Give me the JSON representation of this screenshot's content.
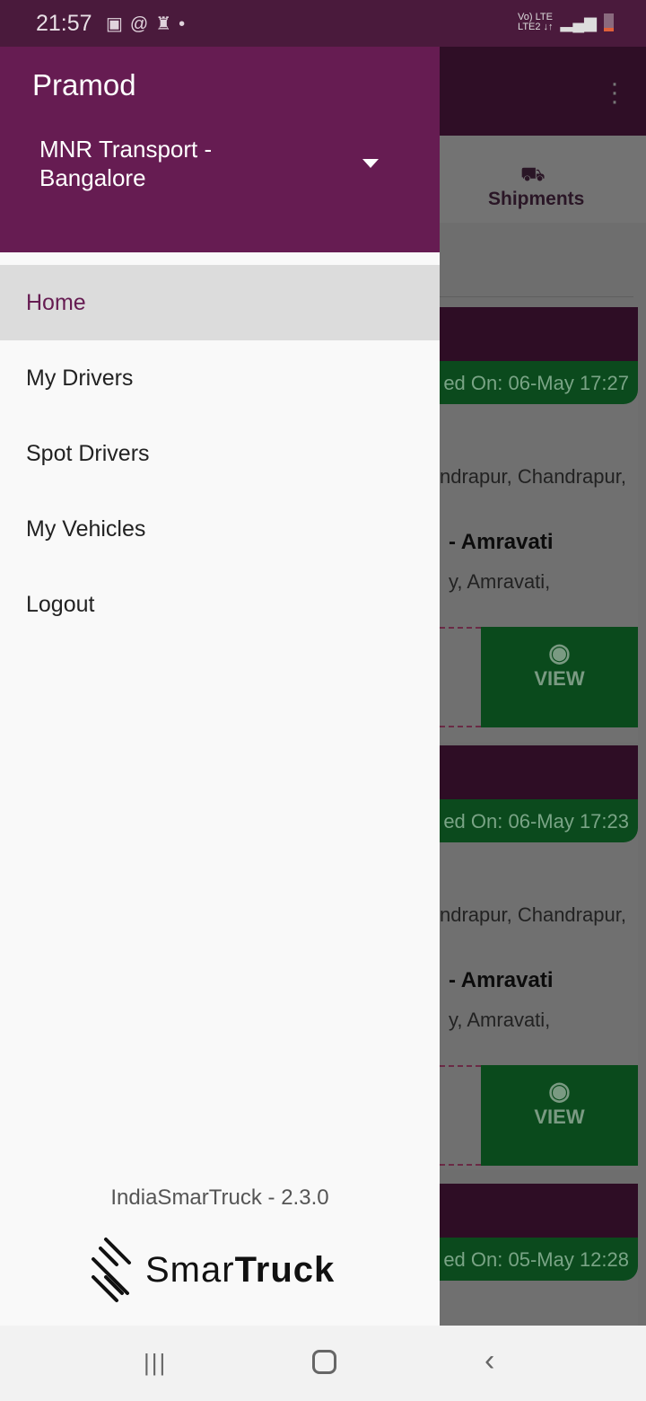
{
  "status_bar": {
    "time": "21:57",
    "left_icons": [
      "gallery-icon",
      "sync-icon",
      "trophy-icon",
      "dot-icon"
    ],
    "network": "VoLTE LTE2",
    "battery": "low"
  },
  "background": {
    "tab": "Shipments",
    "cards": [
      {
        "pill": "ed On: 06-May 17:27",
        "from": "ndrapur, Chandrapur,",
        "to": "- Amravati",
        "to_addr": "y, Amravati,",
        "view": "VIEW"
      },
      {
        "pill": "ed On: 06-May 17:23",
        "from": "ndrapur, Chandrapur,",
        "to": "- Amravati",
        "to_addr": "y, Amravati,",
        "view": "VIEW"
      },
      {
        "pill": "ed On: 05-May 12:28"
      }
    ]
  },
  "drawer": {
    "user": "Pramod",
    "org": "MNR Transport - Bangalore",
    "items": [
      {
        "label": "Home",
        "active": true
      },
      {
        "label": "My Drivers"
      },
      {
        "label": "Spot Drivers"
      },
      {
        "label": "My Vehicles"
      },
      {
        "label": "Logout"
      }
    ],
    "version": "IndiaSmarTruck - 2.3.0",
    "logo": {
      "light": "Smar",
      "bold": "Truck"
    }
  },
  "colors": {
    "primary": "#661c52",
    "accent_green": "#0b6b28"
  }
}
